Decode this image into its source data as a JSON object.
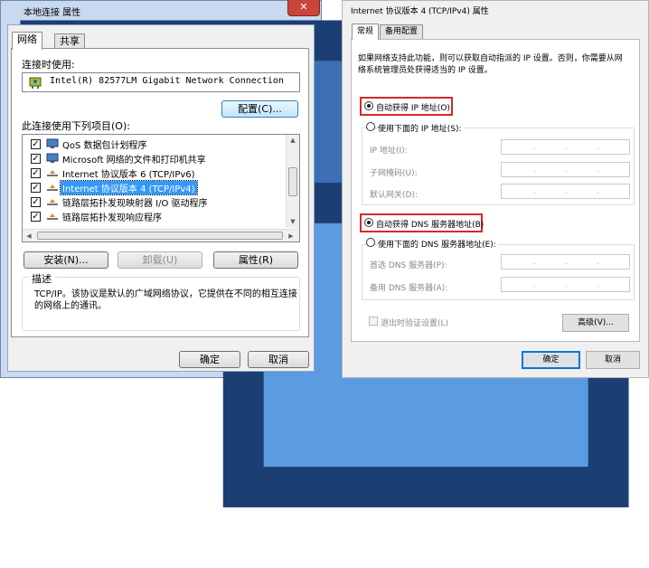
{
  "left_dialog": {
    "title": "本地连接 属性",
    "close_symbol": "✕",
    "tabs": [
      "网络",
      "共享"
    ],
    "connect_using_label": "连接时使用:",
    "adapter_name": "Intel(R) 82577LM Gigabit Network Connection",
    "configure_button": "配置(C)...",
    "items_label": "此连接使用下列项目(O):",
    "items": [
      {
        "label": "QoS 数据包计划程序",
        "checked": true,
        "icon": "qos-icon"
      },
      {
        "label": "Microsoft 网络的文件和打印机共享",
        "checked": true,
        "icon": "share-icon"
      },
      {
        "label": "Internet 协议版本 6 (TCP/IPv6)",
        "checked": true,
        "icon": "protocol-icon"
      },
      {
        "label": "Internet 协议版本 4 (TCP/IPv4)",
        "checked": true,
        "icon": "protocol-icon",
        "selected": true
      },
      {
        "label": "链路层拓扑发现映射器 I/O 驱动程序",
        "checked": true,
        "icon": "protocol-icon"
      },
      {
        "label": "链路层拓扑发现响应程序",
        "checked": true,
        "icon": "protocol-icon"
      }
    ],
    "install_button": "安装(N)...",
    "uninstall_button": "卸载(U)",
    "properties_button": "属性(R)",
    "description_title": "描述",
    "description_text": "TCP/IP。该协议是默认的广域网络协议，它提供在不同的相互连接的网络上的通讯。",
    "ok_button": "确定",
    "cancel_button": "取消"
  },
  "right_dialog": {
    "title": "Internet 协议版本 4 (TCP/IPv4) 属性",
    "tabs": [
      "常规",
      "备用配置"
    ],
    "intro_text_line1": "如果网络支持此功能，则可以获取自动指派的 IP 设置。否则，你需要从网",
    "intro_text_line2": "络系统管理员处获得适当的 IP 设置。",
    "auto_ip_radio": "自动获得 IP 地址(O)",
    "manual_ip_radio": "使用下面的 IP 地址(S):",
    "ip_address_label": "IP 地址(I):",
    "subnet_label": "子网掩码(U):",
    "gateway_label": "默认网关(D):",
    "auto_dns_radio": "自动获得 DNS 服务器地址(B)",
    "manual_dns_radio": "使用下面的 DNS 服务器地址(E):",
    "preferred_dns_label": "首选 DNS 服务器(P):",
    "alternate_dns_label": "备用 DNS 服务器(A):",
    "validate_checkbox": "退出时验证设置(L)",
    "advanced_button": "高级(V)...",
    "ok_button": "确定",
    "cancel_button": "取消",
    "ip_dot": ".",
    "highlight_color": "#d62828"
  }
}
